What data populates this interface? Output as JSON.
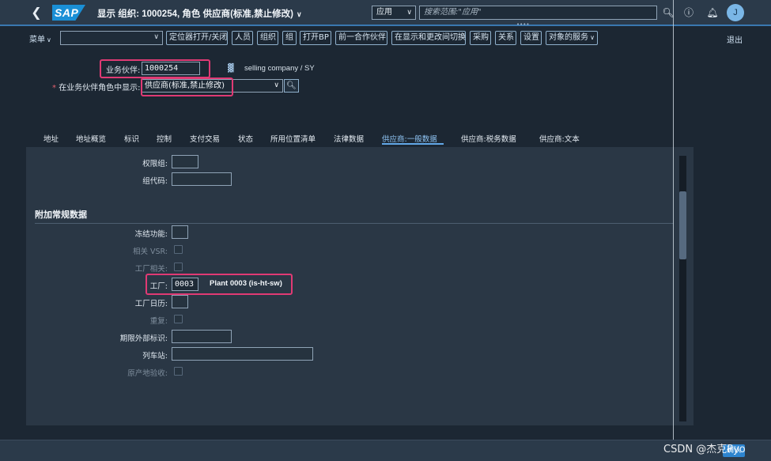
{
  "shell": {
    "back_icon": "back-icon",
    "logo_text": "SAP",
    "title": "显示 组织: 1000254, 角色 供应商(标准,禁止修改)",
    "scope_value": "应用",
    "search_placeholder": "搜索范围:\"应用\"",
    "icons": [
      "search-icon",
      "help-icon",
      "bell-icon"
    ],
    "avatar_initial": "J"
  },
  "toolbar": {
    "menu_label": "菜单",
    "buttons": [
      "定位器打开/关闭",
      "人员",
      "组织",
      "组",
      "打开BP",
      "前一合作伙伴",
      "在显示和更改间切换",
      "采购",
      "关系",
      "设置",
      "对象的服务"
    ],
    "exit_label": "退出"
  },
  "header": {
    "partner_label": "业务伙伴:",
    "partner_value": "1000254",
    "company_text": "selling company / SY",
    "role_label": "在业务伙伴角色中显示:",
    "role_value": "供应商(标准,禁止修改)"
  },
  "tabs": [
    "地址",
    "地址概览",
    "标识",
    "控制",
    "支付交易",
    "状态",
    "所用位置清单",
    "法律数据",
    "供应商:一般数据",
    "供应商:税务数据",
    "供应商:文本"
  ],
  "active_tab_index": 8,
  "content": {
    "auth_group_label": "权限组:",
    "group_code_label": "组代码:",
    "section_title": "附加常规数据",
    "freeze_label": "冻结功能:",
    "vsr_label": "相关 VSR:",
    "plant_relevant_label": "工厂相关:",
    "plant_label": "工厂:",
    "plant_code": "0003",
    "plant_desc": "Plant 0003 (is-ht-sw)",
    "factory_calendar_label": "工厂日历:",
    "repeat_label": "重复:",
    "period_ext_label": "期限外部标识:",
    "train_station_label": "列车站:",
    "origin_check_label": "原产地验收:"
  },
  "footer": {
    "watermark": "CSDN @杰克Pyo",
    "button_label": "确认"
  }
}
